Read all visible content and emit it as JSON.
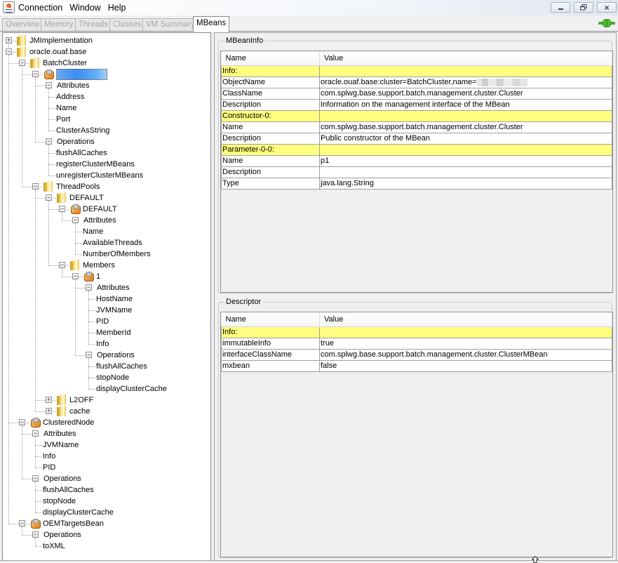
{
  "window": {
    "menu": [
      "Connection",
      "Window",
      "Help"
    ],
    "controls": {
      "minimize": "minimize",
      "restore": "restore",
      "close": "×"
    }
  },
  "tabs": [
    {
      "label": "Overview",
      "enabled": false
    },
    {
      "label": "Memory",
      "enabled": false
    },
    {
      "label": "Threads",
      "enabled": false
    },
    {
      "label": "Classes",
      "enabled": false
    },
    {
      "label": "VM Summary",
      "enabled": false
    },
    {
      "label": "MBeans",
      "enabled": true,
      "active": true
    }
  ],
  "tree": [
    {
      "label": "JMImplementation",
      "type": "folder",
      "depth": 0,
      "expanded": false
    },
    {
      "label": "oracle.ouaf.base",
      "type": "folder",
      "depth": 0,
      "expanded": true
    },
    {
      "label": "BatchCluster",
      "type": "folder",
      "depth": 1,
      "expanded": true
    },
    {
      "label": "",
      "type": "bean",
      "depth": 2,
      "expanded": true,
      "selected": true,
      "redacted": true
    },
    {
      "label": "Attributes",
      "type": "group",
      "depth": 3,
      "expanded": true
    },
    {
      "label": "Address",
      "type": "leaf",
      "depth": 4
    },
    {
      "label": "Name",
      "type": "leaf",
      "depth": 4
    },
    {
      "label": "Port",
      "type": "leaf",
      "depth": 4
    },
    {
      "label": "ClusterAsString",
      "type": "leaf",
      "depth": 4
    },
    {
      "label": "Operations",
      "type": "group",
      "depth": 3,
      "expanded": true
    },
    {
      "label": "flushAllCaches",
      "type": "leaf",
      "depth": 4
    },
    {
      "label": "registerClusterMBeans",
      "type": "leaf",
      "depth": 4
    },
    {
      "label": "unregisterClusterMBeans",
      "type": "leaf",
      "depth": 4
    },
    {
      "label": "ThreadPools",
      "type": "folder",
      "depth": 2,
      "expanded": true
    },
    {
      "label": "DEFAULT",
      "type": "folder",
      "depth": 3,
      "expanded": true
    },
    {
      "label": "DEFAULT",
      "type": "bean",
      "depth": 4,
      "expanded": true
    },
    {
      "label": "Attributes",
      "type": "group",
      "depth": 5,
      "expanded": true
    },
    {
      "label": "Name",
      "type": "leaf",
      "depth": 6
    },
    {
      "label": "AvailableThreads",
      "type": "leaf",
      "depth": 6
    },
    {
      "label": "NumberOfMembers",
      "type": "leaf",
      "depth": 6
    },
    {
      "label": "Members",
      "type": "folder",
      "depth": 4,
      "expanded": true
    },
    {
      "label": "1",
      "type": "bean",
      "depth": 5,
      "expanded": true
    },
    {
      "label": "Attributes",
      "type": "group",
      "depth": 6,
      "expanded": true
    },
    {
      "label": "HostName",
      "type": "leaf",
      "depth": 7
    },
    {
      "label": "JVMName",
      "type": "leaf",
      "depth": 7
    },
    {
      "label": "PID",
      "type": "leaf",
      "depth": 7
    },
    {
      "label": "MemberId",
      "type": "leaf",
      "depth": 7
    },
    {
      "label": "Info",
      "type": "leaf",
      "depth": 7
    },
    {
      "label": "Operations",
      "type": "group",
      "depth": 6,
      "expanded": true
    },
    {
      "label": "flushAllCaches",
      "type": "leaf",
      "depth": 7
    },
    {
      "label": "stopNode",
      "type": "leaf",
      "depth": 7
    },
    {
      "label": "displayClusterCache",
      "type": "leaf",
      "depth": 7
    },
    {
      "label": "L2OFF",
      "type": "folder",
      "depth": 3,
      "expanded": false
    },
    {
      "label": "cache",
      "type": "folder",
      "depth": 3,
      "expanded": false
    },
    {
      "label": "ClusteredNode",
      "type": "bean",
      "depth": 1,
      "expanded": true
    },
    {
      "label": "Attributes",
      "type": "group",
      "depth": 2,
      "expanded": true
    },
    {
      "label": "JVMName",
      "type": "leaf",
      "depth": 3
    },
    {
      "label": "Info",
      "type": "leaf",
      "depth": 3
    },
    {
      "label": "PID",
      "type": "leaf",
      "depth": 3
    },
    {
      "label": "Operations",
      "type": "group",
      "depth": 2,
      "expanded": true
    },
    {
      "label": "flushAllCaches",
      "type": "leaf",
      "depth": 3
    },
    {
      "label": "stopNode",
      "type": "leaf",
      "depth": 3
    },
    {
      "label": "displayClusterCache",
      "type": "leaf",
      "depth": 3
    },
    {
      "label": "OEMTargetsBean",
      "type": "bean",
      "depth": 1,
      "expanded": true
    },
    {
      "label": "Operations",
      "type": "group",
      "depth": 2,
      "expanded": true
    },
    {
      "label": "toXML",
      "type": "leaf",
      "depth": 3
    }
  ],
  "mbeaninfo": {
    "title": "MBeanInfo",
    "columns": [
      "Name",
      "Value"
    ],
    "rows": [
      {
        "name": "Info:",
        "value": "",
        "section": true
      },
      {
        "name": "ObjectName",
        "value": "oracle.ouaf.base:cluster=BatchCluster,name=",
        "redacted": true
      },
      {
        "name": "ClassName",
        "value": "com.splwg.base.support.batch.management.cluster.Cluster"
      },
      {
        "name": "Description",
        "value": "Information on the management interface of the MBean"
      },
      {
        "name": "Constructor-0:",
        "value": "",
        "section": true
      },
      {
        "name": "Name",
        "value": "com.splwg.base.support.batch.management.cluster.Cluster"
      },
      {
        "name": "Description",
        "value": "Public constructor of the MBean"
      },
      {
        "name": "Parameter-0-0:",
        "value": "",
        "section": true
      },
      {
        "name": "Name",
        "value": "p1"
      },
      {
        "name": "Description",
        "value": ""
      },
      {
        "name": "Type",
        "value": "java.lang.String"
      }
    ]
  },
  "descriptor": {
    "title": "Descriptor",
    "columns": [
      "Name",
      "Value"
    ],
    "rows": [
      {
        "name": "Info:",
        "value": "",
        "section": true
      },
      {
        "name": "immutableInfo",
        "value": "true"
      },
      {
        "name": "interfaceClassName",
        "value": "com.splwg.base.support.batch.management.cluster.ClusterMBean"
      },
      {
        "name": "mxbean",
        "value": "false"
      }
    ]
  },
  "colors": {
    "section_highlight": "#ffff80",
    "selection": "#3c8df0",
    "connected_icon": "#3fae2a"
  }
}
